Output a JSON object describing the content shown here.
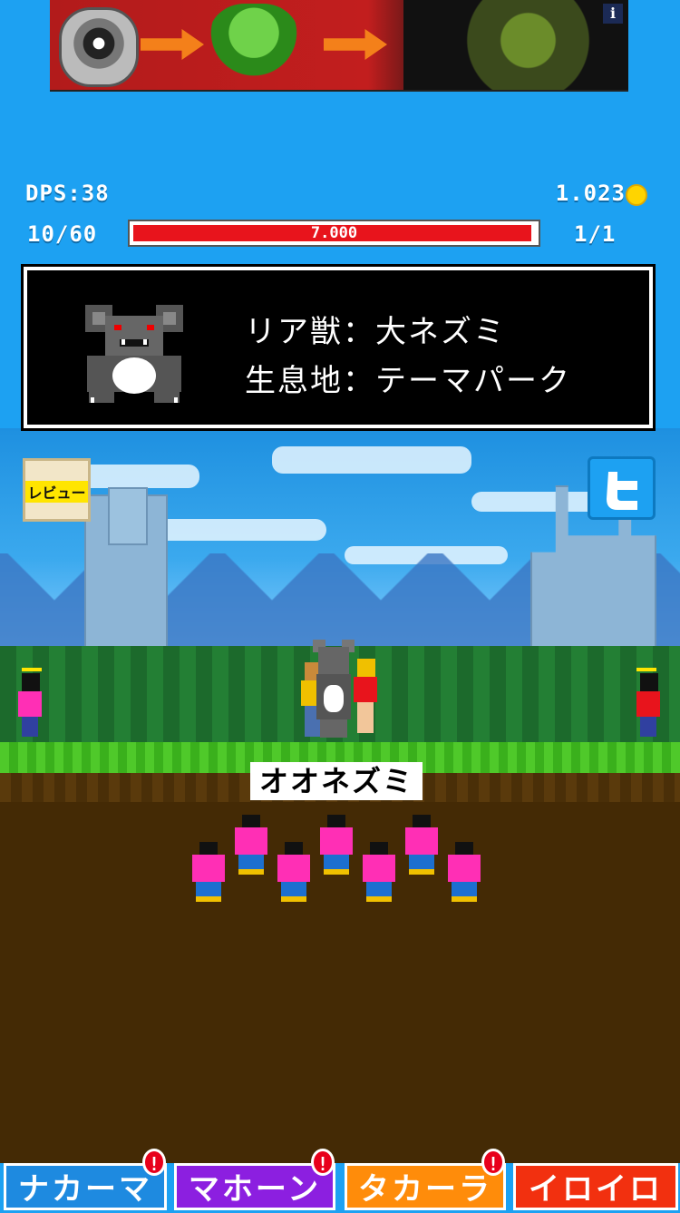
{
  "ad": {
    "info_label": "i"
  },
  "hud": {
    "dps": "DPS:38",
    "gold": "1.023",
    "kills": "10/60",
    "stage": "1/1",
    "hp_value": "7.000",
    "hp_fraction": 0.99
  },
  "panel": {
    "rarity": "リア獣：大ネズミ",
    "habitat": "生息地：テーマパーク"
  },
  "scene": {
    "review_label": "レビュー",
    "monster_name": "オオネズミ"
  },
  "tabs": [
    {
      "label": "ナカーマ",
      "alert": "!"
    },
    {
      "label": "マホーン",
      "alert": "!"
    },
    {
      "label": "タカーラ",
      "alert": "!"
    },
    {
      "label": "イロイロ"
    }
  ],
  "colors": {
    "background": "#1da1f2",
    "hp_bar": "#e8141c",
    "tab_nakama": "#1e8ae0",
    "tab_mahon": "#8c1fe0",
    "tab_takara": "#ff8c0a",
    "tab_iroiro": "#f2300f",
    "minion": "#ff2fb5"
  }
}
